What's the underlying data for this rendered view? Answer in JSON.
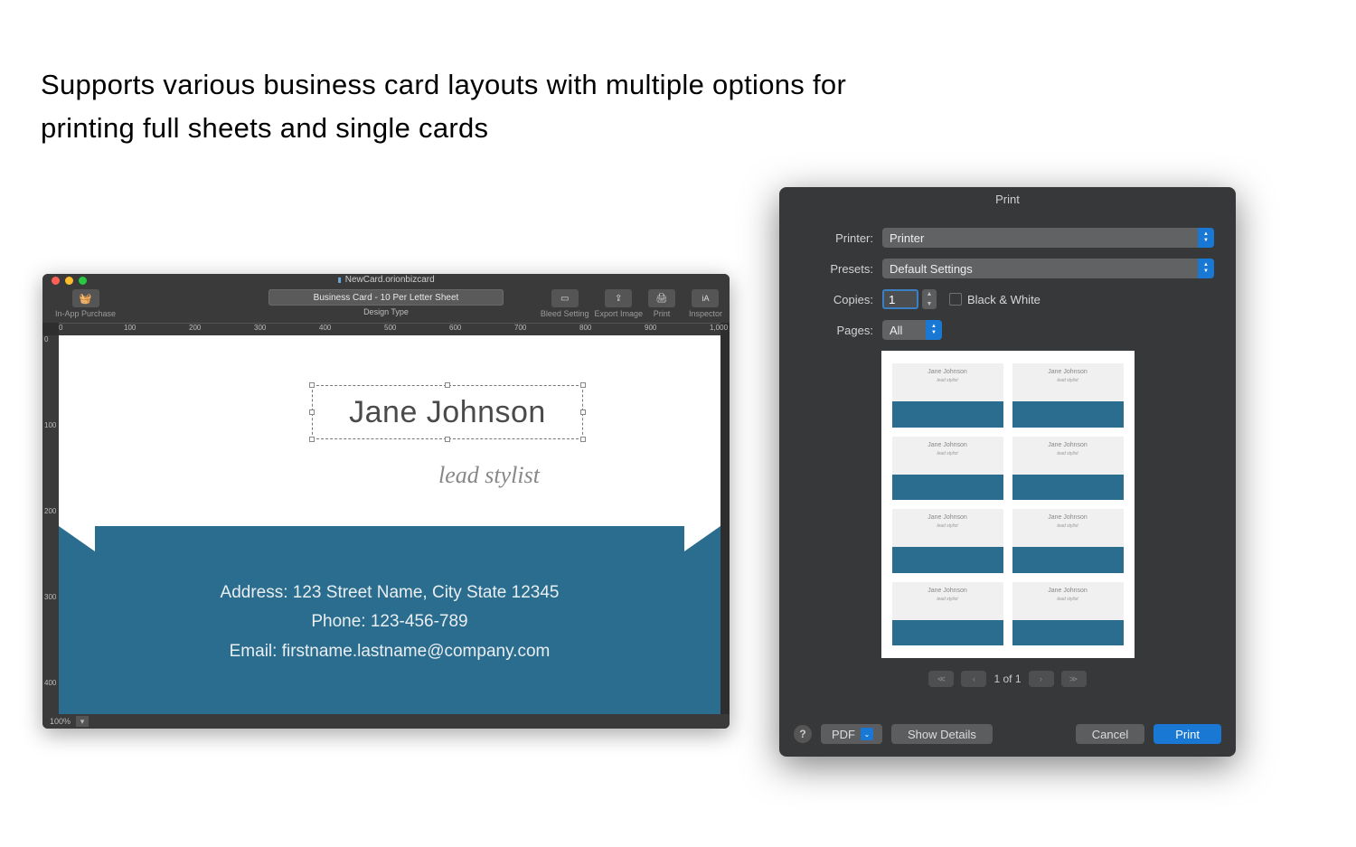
{
  "caption_line1": "Supports various business card layouts with multiple options for",
  "caption_line2": "printing full sheets and single cards",
  "editor": {
    "doc_title": "NewCard.orionbizcard",
    "toolbar": {
      "in_app_purchase": "In-App Purchase",
      "design_type_value": "Business Card - 10 Per Letter Sheet",
      "design_type_label": "Design Type",
      "bleed_setting": "Bleed Setting",
      "export_image": "Export Image",
      "print": "Print",
      "inspector": "Inspector"
    },
    "ruler_h": [
      "0",
      "100",
      "200",
      "300",
      "400",
      "500",
      "600",
      "700",
      "800",
      "900",
      "1,000"
    ],
    "ruler_v": [
      "0",
      "100",
      "200",
      "300",
      "400"
    ],
    "card": {
      "name": "Jane Johnson",
      "subtitle": "lead stylist",
      "address": "Address:  123 Street Name, City State 12345",
      "phone": "Phone: 123-456-789",
      "email": "Email: firstname.lastname@company.com"
    },
    "zoom": "100%"
  },
  "print": {
    "title": "Print",
    "printer_label": "Printer:",
    "printer_value": "Printer",
    "presets_label": "Presets:",
    "presets_value": "Default Settings",
    "copies_label": "Copies:",
    "copies_value": "1",
    "bw_label": "Black & White",
    "pages_label": "Pages:",
    "pages_value": "All",
    "preview_name": "Jane Johnson",
    "preview_sub": "lead stylist",
    "pager": "1 of 1",
    "help": "?",
    "pdf": "PDF",
    "show_details": "Show Details",
    "cancel": "Cancel",
    "print_btn": "Print"
  }
}
